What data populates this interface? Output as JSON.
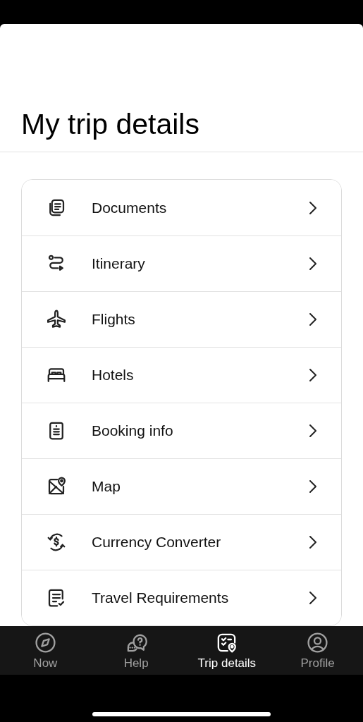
{
  "title": "My trip details",
  "menu": [
    {
      "kind": "documents",
      "label": "Documents"
    },
    {
      "kind": "itinerary",
      "label": "Itinerary"
    },
    {
      "kind": "flights",
      "label": "Flights"
    },
    {
      "kind": "hotels",
      "label": "Hotels"
    },
    {
      "kind": "booking",
      "label": "Booking info"
    },
    {
      "kind": "map",
      "label": "Map"
    },
    {
      "kind": "currency",
      "label": "Currency Converter"
    },
    {
      "kind": "requirements",
      "label": "Travel Requirements"
    }
  ],
  "tab_bar": [
    {
      "kind": "now",
      "label": "Now",
      "selected": false
    },
    {
      "kind": "help",
      "label": "Help",
      "selected": false
    },
    {
      "kind": "trip",
      "label": "Trip details",
      "selected": true
    },
    {
      "kind": "profile",
      "label": "Profile",
      "selected": false
    }
  ]
}
